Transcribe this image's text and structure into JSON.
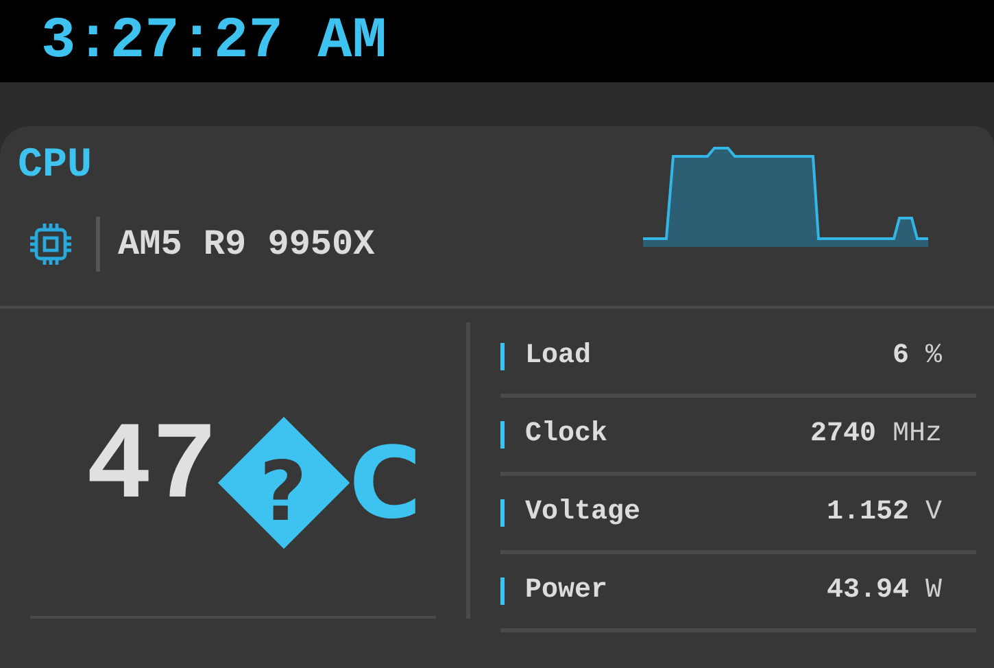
{
  "clock": "3:27:27 AM",
  "card": {
    "title": "CPU",
    "model": "AM5 R9 9950X",
    "temperature": {
      "value": "47",
      "sign": "?",
      "unit": "C"
    },
    "metrics": [
      {
        "label": "Load",
        "value": "6",
        "unit": "%"
      },
      {
        "label": "Clock",
        "value": "2740",
        "unit": "MHz"
      },
      {
        "label": "Voltage",
        "value": "1.152",
        "unit": "V"
      },
      {
        "label": "Power",
        "value": "43.94",
        "unit": "W"
      }
    ]
  }
}
